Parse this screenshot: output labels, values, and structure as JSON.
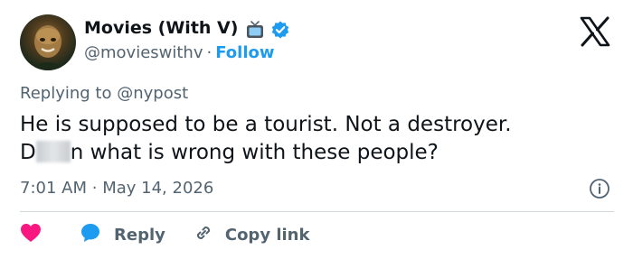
{
  "author": {
    "display_name": "Movies (With V)",
    "handle": "@movieswithv",
    "separator": "·",
    "follow_label": "Follow",
    "verified": true,
    "icons": [
      "tv-icon",
      "verified-badge-icon"
    ]
  },
  "platform": {
    "logo": "x-logo-icon"
  },
  "reply_context": {
    "prefix": "Replying to",
    "mention": "@nypost"
  },
  "tweet": {
    "line1": "He is supposed to be a tourist. Not a destroyer.",
    "line2_start": "D",
    "line2_end": "n what is wrong with these people?"
  },
  "meta": {
    "time": "7:01 AM",
    "separator": "·",
    "date": "May 14, 2026"
  },
  "actions": {
    "reply_label": "Reply",
    "copy_link_label": "Copy link"
  },
  "colors": {
    "accent": "#1d9bf0",
    "like": "#f91880",
    "text": "#0f1419",
    "muted": "#536471",
    "divider": "#cfd9de"
  }
}
